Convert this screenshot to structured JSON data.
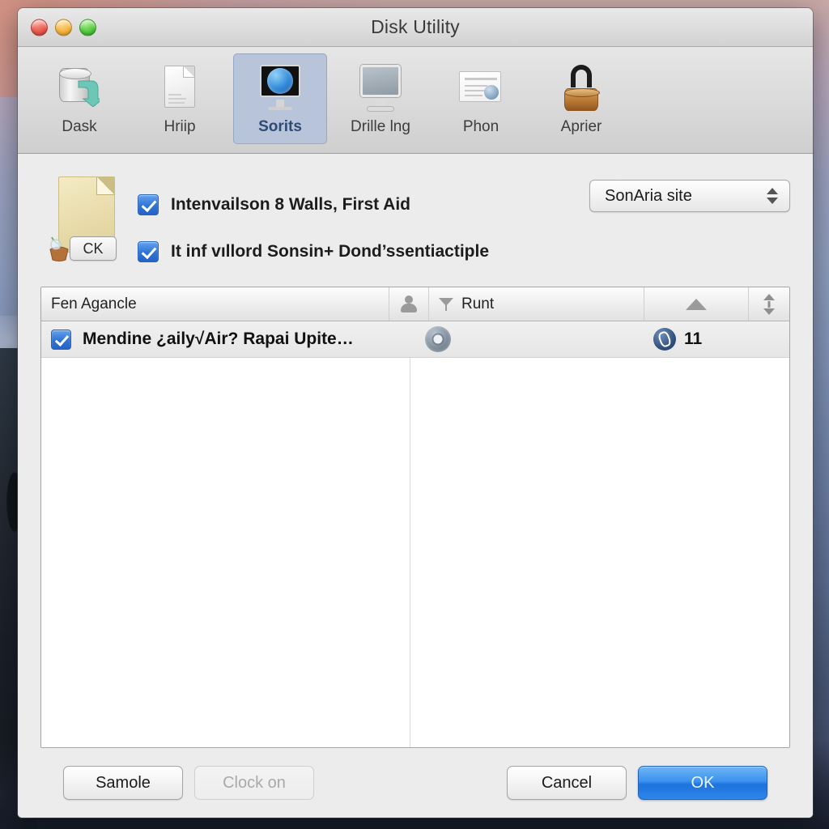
{
  "window": {
    "title": "Disk Utility",
    "traffic_lights": [
      "close",
      "minimize",
      "zoom"
    ]
  },
  "toolbar": {
    "items": [
      {
        "label": "Dask",
        "icon": "disk-arrow-icon",
        "selected": false
      },
      {
        "label": "Hriip",
        "icon": "document-icon",
        "selected": false
      },
      {
        "label": "Sorits",
        "icon": "monitor-globe-icon",
        "selected": true
      },
      {
        "label": "Drille lng",
        "icon": "monitor-icon",
        "selected": false
      },
      {
        "label": "Phon",
        "icon": "certificate-icon",
        "selected": false
      },
      {
        "label": "Aprier",
        "icon": "lock-barrel-icon",
        "selected": false
      }
    ]
  },
  "top_section": {
    "file_icon": {
      "icon": "document-basket-icon",
      "badge_label": "CK"
    },
    "checkboxes": [
      {
        "label": "Intenvailson 8 Walls, First Aid",
        "checked": true
      },
      {
        "label": "It inf vıllord Sonsin+ Dond’ssentiactiple",
        "checked": true
      }
    ],
    "popup": {
      "value": "SonAria site",
      "icon": "stepper-arrows-icon"
    }
  },
  "table": {
    "columns": [
      {
        "label": "Fen Agancle",
        "icon": null
      },
      {
        "label": "",
        "icon": "person-icon"
      },
      {
        "label": "Runt",
        "icon": "filter-icon"
      },
      {
        "label": "",
        "icon": "tent-icon"
      },
      {
        "label": "",
        "icon": "sort-arrows-icon"
      }
    ],
    "rows": [
      {
        "checked": true,
        "name": "Mendine ¿aily√Air? Rapai Upite…",
        "status_icon": "disc-icon",
        "badge_icon": "pen-badge-icon",
        "badge_count": "11"
      }
    ]
  },
  "footer": {
    "buttons": [
      {
        "label": "Samole",
        "style": "normal",
        "disabled": false
      },
      {
        "label": "Clock on",
        "style": "normal",
        "disabled": true
      },
      {
        "label": "Cancel",
        "style": "normal",
        "disabled": false
      },
      {
        "label": "OK",
        "style": "default",
        "disabled": false
      }
    ]
  },
  "colors": {
    "accent_blue": "#2f74d6",
    "default_button": "#3b92ef",
    "selected_toolbar": "#b7c4da",
    "window_bg": "#ececec",
    "table_bg": "#ffffff"
  }
}
